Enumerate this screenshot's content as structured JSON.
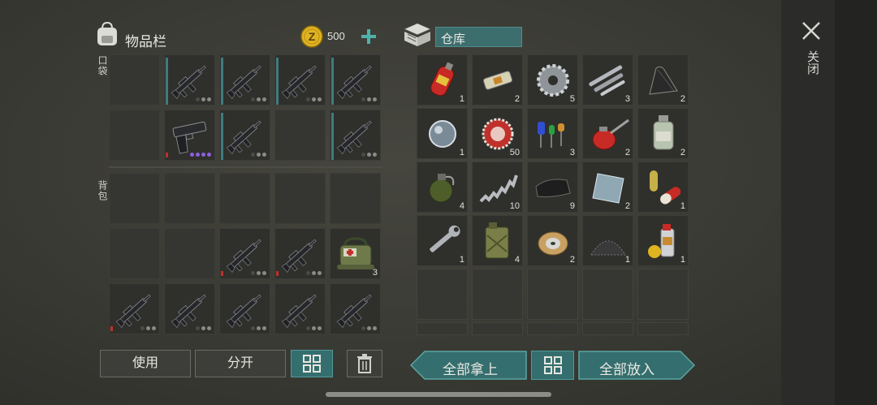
{
  "inventory": {
    "title": "物品栏",
    "coin_amount": "500",
    "pocket_label": "口袋",
    "backpack_label": "背包"
  },
  "warehouse": {
    "title": "仓库",
    "item_counts": [
      "1",
      "2",
      "5",
      "3",
      "2",
      "1",
      "50",
      "3",
      "2",
      "2",
      "4",
      "10",
      "9",
      "2",
      "1",
      "1",
      "4",
      "2",
      "1",
      "1"
    ]
  },
  "medkit_count": "3",
  "close_label": "关闭",
  "buttons": {
    "use": "使用",
    "split": "分开",
    "take_all": "全部拿上",
    "put_all": "全部放入"
  },
  "colors": {
    "teal_accent": "#356e6e",
    "bar_teal": "#3f7c80",
    "bar_red": "#c0312b",
    "coin_gold": "#e0b320"
  },
  "icons": [
    "backpack-icon",
    "coin-icon",
    "plus-icon",
    "storage-box-icon",
    "close-icon",
    "grid-icon",
    "trash-icon",
    "rifle-icon",
    "pistol-icon",
    "medkit-icon"
  ]
}
